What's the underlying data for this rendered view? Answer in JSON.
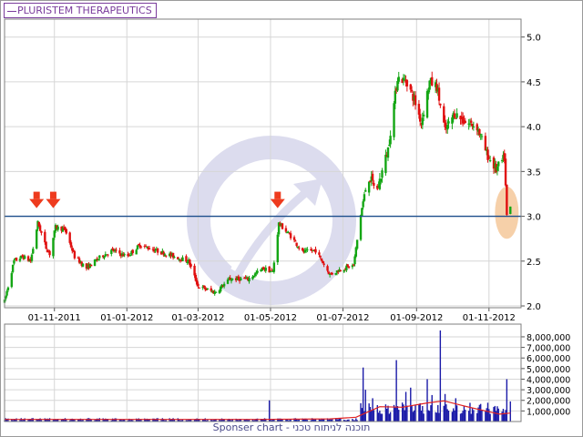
{
  "header": {
    "series_label": "PLURISTEM THERAPEUTICS"
  },
  "footer": {
    "credit": "Sponser chart - תוכנה לניתוח טכני"
  },
  "colors": {
    "up": "#14a614",
    "down": "#e01010",
    "hline": "#1c4e8c",
    "volume": "#1a1aa8",
    "volume_ma": "#e02020",
    "grid": "#d6d6d6",
    "highlight": "#f5c89a",
    "arrow": "#ee3b1e",
    "watermark": "#dcdcee"
  },
  "icons": {
    "signal_marker": "arrow-down-icon",
    "watermark": "circular-arrow-logo-icon"
  },
  "chart_data": [
    {
      "type": "candlestick",
      "title": "",
      "xlabel": "",
      "ylabel": "",
      "x_ticks": [
        "01-11-2011",
        "01-01-2012",
        "01-03-2012",
        "01-05-2012",
        "01-07-2012",
        "01-09-2012",
        "01-11-2012"
      ],
      "y_ticks": [
        "2.0",
        "2.5",
        "3.0",
        "3.5",
        "4.0",
        "4.5",
        "5.0"
      ],
      "ylim": [
        1.98,
        5.2
      ],
      "xlim": [
        "2011-09-20",
        "2012-11-28"
      ],
      "grid": true,
      "y_axis_side": "right",
      "horizontal_line": 3.0,
      "signal_arrows": [
        "2011-10-17",
        "2011-10-31",
        "2012-05-07"
      ],
      "highlight": {
        "date": "2012-11-16",
        "low": 2.78,
        "high": 3.3
      },
      "price_path": [
        [
          "2011-09-20",
          2.05
        ],
        [
          "2011-09-28",
          2.5
        ],
        [
          "2011-10-05",
          2.55
        ],
        [
          "2011-10-12",
          2.5
        ],
        [
          "2011-10-18",
          2.93
        ],
        [
          "2011-10-25",
          2.65
        ],
        [
          "2011-10-28",
          2.58
        ],
        [
          "2011-11-02",
          2.88
        ],
        [
          "2011-11-10",
          2.85
        ],
        [
          "2011-11-18",
          2.55
        ],
        [
          "2011-11-28",
          2.42
        ],
        [
          "2011-12-10",
          2.55
        ],
        [
          "2011-12-20",
          2.62
        ],
        [
          "2012-01-01",
          2.55
        ],
        [
          "2012-01-12",
          2.68
        ],
        [
          "2012-01-25",
          2.62
        ],
        [
          "2012-02-10",
          2.55
        ],
        [
          "2012-02-22",
          2.5
        ],
        [
          "2012-03-01",
          2.22
        ],
        [
          "2012-03-15",
          2.15
        ],
        [
          "2012-03-28",
          2.3
        ],
        [
          "2012-04-12",
          2.3
        ],
        [
          "2012-04-25",
          2.42
        ],
        [
          "2012-05-03",
          2.38
        ],
        [
          "2012-05-08",
          2.92
        ],
        [
          "2012-05-18",
          2.78
        ],
        [
          "2012-05-28",
          2.6
        ],
        [
          "2012-06-08",
          2.62
        ],
        [
          "2012-06-20",
          2.35
        ],
        [
          "2012-07-01",
          2.42
        ],
        [
          "2012-07-10",
          2.45
        ],
        [
          "2012-07-16",
          3.02
        ],
        [
          "2012-07-22",
          3.45
        ],
        [
          "2012-07-30",
          3.3
        ],
        [
          "2012-08-08",
          3.75
        ],
        [
          "2012-08-16",
          4.55
        ],
        [
          "2012-08-24",
          4.5
        ],
        [
          "2012-08-30",
          4.3
        ],
        [
          "2012-09-05",
          4.05
        ],
        [
          "2012-09-12",
          4.5
        ],
        [
          "2012-09-18",
          4.45
        ],
        [
          "2012-09-25",
          3.95
        ],
        [
          "2012-10-03",
          4.15
        ],
        [
          "2012-10-12",
          4.05
        ],
        [
          "2012-10-22",
          4.0
        ],
        [
          "2012-10-30",
          3.7
        ],
        [
          "2012-11-07",
          3.52
        ],
        [
          "2012-11-14",
          3.65
        ],
        [
          "2012-11-16",
          3.0
        ],
        [
          "2012-11-19",
          3.1
        ]
      ]
    },
    {
      "type": "bar",
      "title": "",
      "y_ticks": [
        "1,000,000",
        "2,000,000",
        "3,000,000",
        "4,000,000",
        "5,000,000",
        "6,000,000",
        "7,000,000",
        "8,000,000"
      ],
      "ylim": [
        0,
        9200000
      ],
      "grid": true,
      "y_axis_side": "right",
      "volume_spikes": [
        [
          "2012-04-30",
          2000000
        ],
        [
          "2012-07-18",
          5100000
        ],
        [
          "2012-07-20",
          3000000
        ],
        [
          "2012-07-26",
          2200000
        ],
        [
          "2012-08-15",
          5800000
        ],
        [
          "2012-08-23",
          2800000
        ],
        [
          "2012-08-27",
          3200000
        ],
        [
          "2012-09-10",
          4000000
        ],
        [
          "2012-09-14",
          2500000
        ],
        [
          "2012-09-21",
          8600000
        ],
        [
          "2012-09-25",
          2600000
        ],
        [
          "2012-10-04",
          2200000
        ],
        [
          "2012-11-13",
          1200000
        ],
        [
          "2012-11-16",
          4000000
        ],
        [
          "2012-11-19",
          1900000
        ]
      ],
      "baseline_volume": 180000,
      "moving_average": [
        [
          "2011-09-20",
          200000
        ],
        [
          "2012-04-20",
          200000
        ],
        [
          "2012-06-20",
          250000
        ],
        [
          "2012-07-12",
          400000
        ],
        [
          "2012-08-01",
          1400000
        ],
        [
          "2012-08-20",
          1350000
        ],
        [
          "2012-09-10",
          1750000
        ],
        [
          "2012-09-24",
          1950000
        ],
        [
          "2012-10-10",
          1500000
        ],
        [
          "2012-10-25",
          1100000
        ],
        [
          "2012-11-10",
          700000
        ],
        [
          "2012-11-19",
          800000
        ]
      ]
    }
  ]
}
